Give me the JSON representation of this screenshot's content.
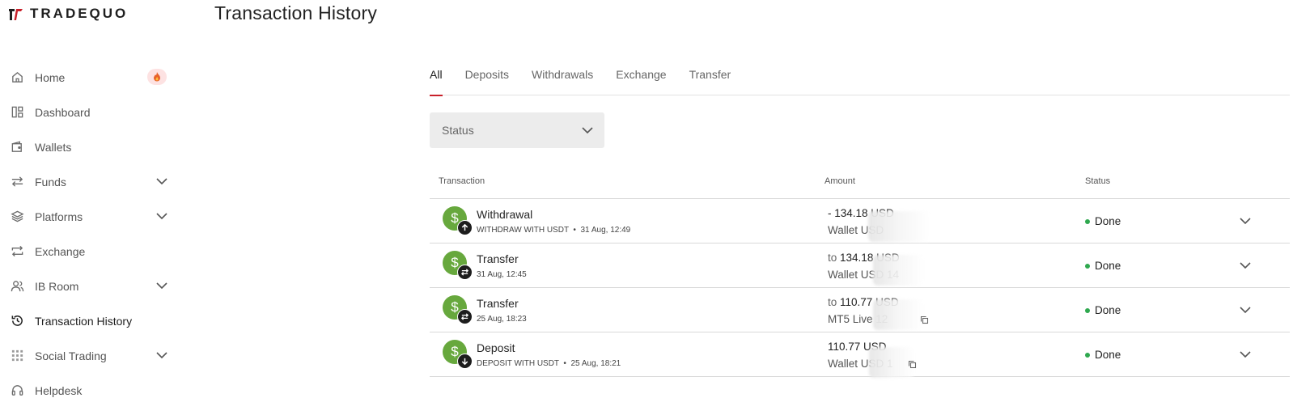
{
  "brand": {
    "name": "TRADEQUO",
    "accent": "#c8202a"
  },
  "page": {
    "title": "Transaction History"
  },
  "sidebar": {
    "items": [
      {
        "label": "Home",
        "icon": "home-icon",
        "badge": "fire-icon"
      },
      {
        "label": "Dashboard",
        "icon": "dashboard-icon"
      },
      {
        "label": "Wallets",
        "icon": "wallet-icon"
      },
      {
        "label": "Funds",
        "icon": "transfer-arrows-icon",
        "expandable": true
      },
      {
        "label": "Platforms",
        "icon": "layers-icon",
        "expandable": true
      },
      {
        "label": "Exchange",
        "icon": "exchange-icon"
      },
      {
        "label": "IB Room",
        "icon": "users-icon",
        "expandable": true
      },
      {
        "label": "Transaction History",
        "icon": "history-icon",
        "active": true
      },
      {
        "label": "Social Trading",
        "icon": "grid-icon",
        "expandable": true
      },
      {
        "label": "Helpdesk",
        "icon": "headset-icon"
      }
    ]
  },
  "tabs": [
    {
      "label": "All",
      "active": true
    },
    {
      "label": "Deposits"
    },
    {
      "label": "Withdrawals"
    },
    {
      "label": "Exchange"
    },
    {
      "label": "Transfer"
    }
  ],
  "filter": {
    "status_label": "Status"
  },
  "table": {
    "headers": {
      "transaction": "Transaction",
      "amount": "Amount",
      "status": "Status"
    },
    "rows": [
      {
        "title": "Withdrawal",
        "method": "WITHDRAW WITH USDT",
        "date": "31 Aug, 12:49",
        "sub_icon": "arrow-up-icon",
        "amount_prefix": "",
        "amount": "- 134.18 USD",
        "account": "Wallet USD",
        "status": "Done"
      },
      {
        "title": "Transfer",
        "method": "",
        "date": "31 Aug, 12:45",
        "sub_icon": "swap-arrows-icon",
        "amount_prefix": "to",
        "amount": "134.18 USD",
        "account": "Wallet USD 14",
        "status": "Done"
      },
      {
        "title": "Transfer",
        "method": "",
        "date": "25 Aug, 18:23",
        "sub_icon": "swap-arrows-icon",
        "amount_prefix": "to",
        "amount": "110.77 USD",
        "account": "MT5 Live 12",
        "status": "Done"
      },
      {
        "title": "Deposit",
        "method": "DEPOSIT WITH USDT",
        "date": "25 Aug, 18:21",
        "sub_icon": "arrow-down-icon",
        "amount_prefix": "",
        "amount": "110.77 USD",
        "account": "Wallet USD 1",
        "status": "Done"
      }
    ]
  },
  "colors": {
    "status_done": "#2fa84f",
    "tx_icon_bg": "#67a83d"
  }
}
